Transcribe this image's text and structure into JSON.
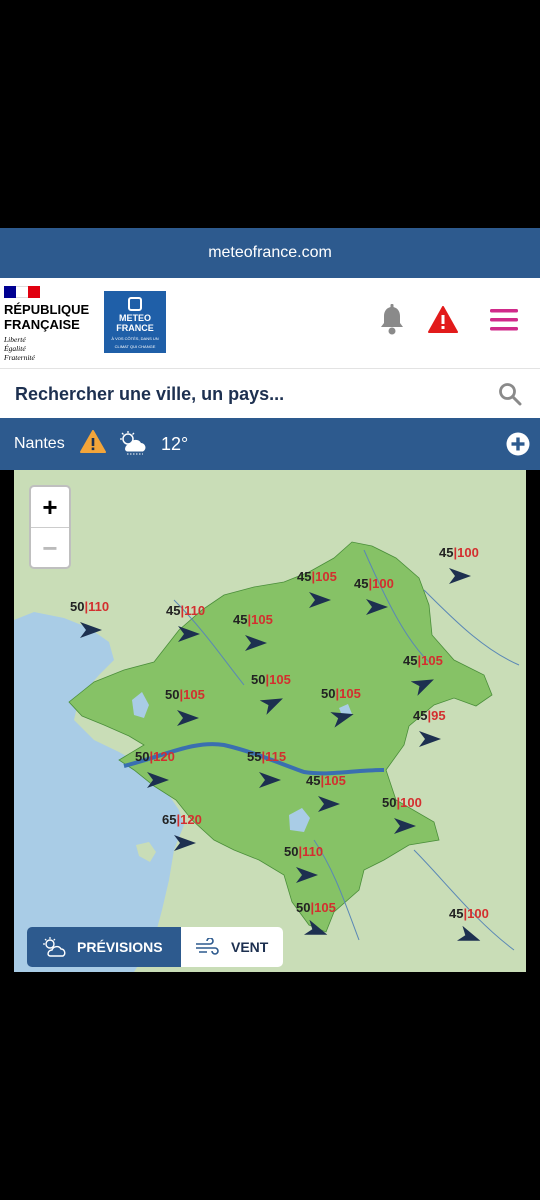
{
  "browser": {
    "url": "meteofrance.com"
  },
  "header": {
    "republique": "RÉPUBLIQUE",
    "francaise": "FRANÇAISE",
    "motto": [
      "Liberté",
      "Égalité",
      "Fraternité"
    ],
    "logo": {
      "line1": "METEO",
      "line2": "FRANCE",
      "tagline1": "À VOS CÔTÉS, DANS UN",
      "tagline2": "CLIMAT QUI CHANGE"
    },
    "icons": [
      "bell-icon",
      "warning-icon",
      "menu-icon"
    ]
  },
  "search": {
    "placeholder": "Rechercher une ville, un pays..."
  },
  "city_bar": {
    "city": "Nantes",
    "temperature": "12°",
    "icons": [
      "warning-icon",
      "cloud-sun-icon",
      "add-icon"
    ]
  },
  "map": {
    "zoom_in": "+",
    "zoom_out": "−",
    "wind_labels": [
      {
        "avg": "45",
        "gust": "100"
      },
      {
        "avg": "45",
        "gust": "105"
      },
      {
        "avg": "45",
        "gust": "100"
      },
      {
        "avg": "50",
        "gust": "110"
      },
      {
        "avg": "45",
        "gust": "110"
      },
      {
        "avg": "45",
        "gust": "105"
      },
      {
        "avg": "45",
        "gust": "105"
      },
      {
        "avg": "50",
        "gust": "105"
      },
      {
        "avg": "50",
        "gust": "105"
      },
      {
        "avg": "50",
        "gust": "105"
      },
      {
        "avg": "45",
        "gust": "95"
      },
      {
        "avg": "50",
        "gust": "120"
      },
      {
        "avg": "55",
        "gust": "115"
      },
      {
        "avg": "45",
        "gust": "105"
      },
      {
        "avg": "50",
        "gust": "100"
      },
      {
        "avg": "65",
        "gust": "120"
      },
      {
        "avg": "50",
        "gust": "110"
      },
      {
        "avg": "50",
        "gust": "105"
      },
      {
        "avg": "45",
        "gust": "100"
      }
    ],
    "toggle": {
      "previsions": "PRÉVISIONS",
      "vent": "VENT"
    },
    "colors": {
      "sea": "#a9cce6",
      "department": "#86c266",
      "land": "#c9ddb7",
      "arrow": "#1d3050",
      "gust": "#d32f2f"
    }
  }
}
